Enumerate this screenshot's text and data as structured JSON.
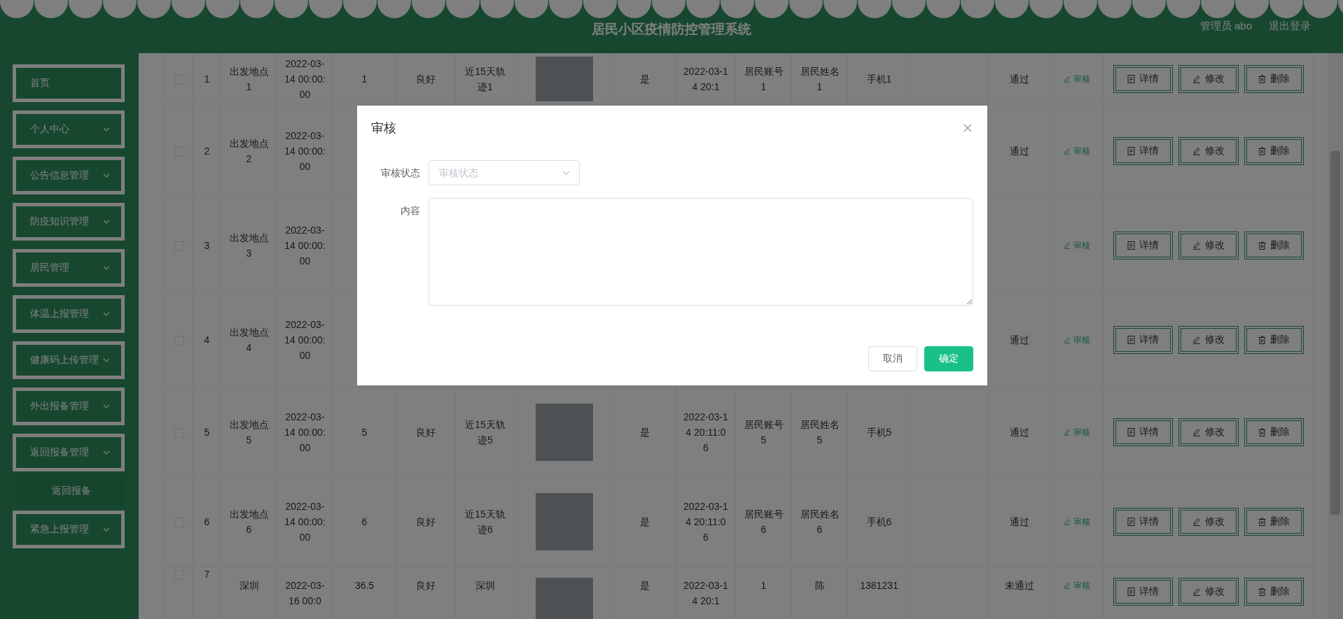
{
  "header": {
    "title": "居民小区疫情防控管理系统",
    "user": "管理员 abo",
    "logout": "退出登录"
  },
  "sidebar": {
    "items": [
      {
        "kind": "link",
        "label": "首页"
      },
      {
        "kind": "menu",
        "label": "个人中心"
      },
      {
        "kind": "menu",
        "label": "公告信息管理"
      },
      {
        "kind": "menu",
        "label": "防疫知识管理"
      },
      {
        "kind": "menu",
        "label": "居民管理"
      },
      {
        "kind": "menu",
        "label": "体温上报管理"
      },
      {
        "kind": "menu",
        "label": "健康码上传管理"
      },
      {
        "kind": "menu",
        "label": "外出报备管理"
      },
      {
        "kind": "menu",
        "label": "返回报备管理",
        "children": [
          {
            "label": "返回报备"
          }
        ]
      },
      {
        "kind": "menu",
        "label": "紧急上报管理"
      }
    ]
  },
  "table": {
    "rows": [
      {
        "checked": false,
        "index": "1",
        "departure": "出发地点1",
        "departure_time": "2022-03-14 00:00:00",
        "temperature": "1",
        "health": "良好",
        "trajectory": "近15天轨迹1",
        "photo": true,
        "at_risk": "是",
        "report_time": "2022-03-14 20:1",
        "account": "居民账号1",
        "name": "居民姓名1",
        "phone": "手机1",
        "review_status": "通过",
        "review_action": "审核",
        "actions": [
          {
            "kind": "detail",
            "label": "详情"
          },
          {
            "kind": "edit",
            "label": "修改"
          },
          {
            "kind": "delete",
            "label": "删除"
          }
        ]
      },
      {
        "checked": false,
        "index": "2",
        "departure": "出发地点2",
        "departure_time": "2022-03-14 00:00:00",
        "review_status": "通过",
        "review_action": "审核",
        "actions": [
          {
            "kind": "detail",
            "label": "详情"
          },
          {
            "kind": "edit",
            "label": "修改"
          },
          {
            "kind": "delete",
            "label": "删除"
          }
        ]
      },
      {
        "checked": false,
        "index": "3",
        "departure": "出发地点3",
        "departure_time": "2022-03-14 00:00:00",
        "review_action": "审核",
        "actions": [
          {
            "kind": "detail",
            "label": "详情"
          },
          {
            "kind": "edit",
            "label": "修改"
          },
          {
            "kind": "delete",
            "label": "删除"
          }
        ]
      },
      {
        "checked": false,
        "index": "4",
        "departure": "出发地点4",
        "departure_time": "2022-03-14 00:00:00",
        "review_status": "通过",
        "review_action": "审核",
        "actions": [
          {
            "kind": "detail",
            "label": "详情"
          },
          {
            "kind": "edit",
            "label": "修改"
          },
          {
            "kind": "delete",
            "label": "删除"
          }
        ]
      },
      {
        "checked": false,
        "index": "5",
        "departure": "出发地点5",
        "departure_time": "2022-03-14 00:00:00",
        "temperature": "5",
        "health": "良好",
        "trajectory": "近15天轨迹5",
        "photo": true,
        "at_risk": "是",
        "report_time": "2022-03-14 20:11:06",
        "account": "居民账号5",
        "name": "居民姓名5",
        "phone": "手机5",
        "review_status": "通过",
        "review_action": "审核",
        "actions": [
          {
            "kind": "detail",
            "label": "详情"
          },
          {
            "kind": "edit",
            "label": "修改"
          },
          {
            "kind": "delete",
            "label": "删除"
          }
        ]
      },
      {
        "checked": false,
        "index": "6",
        "departure": "出发地点6",
        "departure_time": "2022-03-14 00:00:00",
        "temperature": "6",
        "health": "良好",
        "trajectory": "近15天轨迹6",
        "photo": true,
        "at_risk": "是",
        "report_time": "2022-03-14 20:11:06",
        "account": "居民账号6",
        "name": "居民姓名6",
        "phone": "手机6",
        "review_status": "通过",
        "review_action": "审核",
        "actions": [
          {
            "kind": "detail",
            "label": "详情"
          },
          {
            "kind": "edit",
            "label": "修改"
          },
          {
            "kind": "delete",
            "label": "删除"
          }
        ]
      },
      {
        "checked": false,
        "index": "7",
        "departure": "深圳",
        "departure_time": "2022-03-16 00:0",
        "temperature": "36.5",
        "health": "良好",
        "trajectory": "深圳",
        "photo": true,
        "at_risk": "是",
        "report_time": "2022-03-14 20:1",
        "account": "1",
        "name": "陈",
        "phone": "1381231",
        "review_status": "未通过",
        "review_action": "审核",
        "actions": [
          {
            "kind": "detail",
            "label": "详情"
          },
          {
            "kind": "edit",
            "label": "修改"
          },
          {
            "kind": "delete",
            "label": "删除"
          }
        ]
      }
    ]
  },
  "dialog": {
    "title": "审核",
    "fields": [
      {
        "kind": "select",
        "label": "审核状态",
        "placeholder": "审核状态"
      },
      {
        "kind": "textarea",
        "label": "内容"
      }
    ],
    "buttons": [
      {
        "kind": "secondary",
        "label": "取消"
      },
      {
        "kind": "primary",
        "label": "确定"
      }
    ]
  }
}
